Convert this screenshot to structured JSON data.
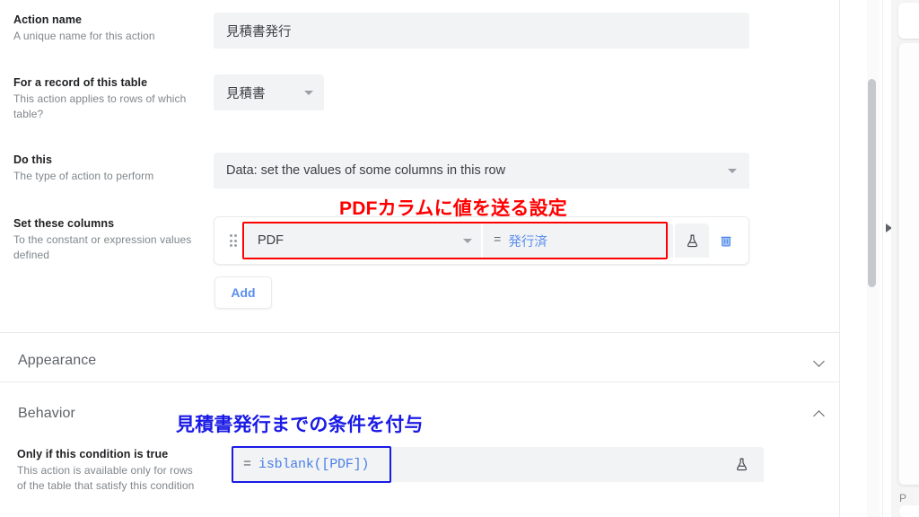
{
  "form": {
    "fields": [
      {
        "label": "Action name",
        "help": "A unique name for this action",
        "value": "見積書発行",
        "kind": "text"
      },
      {
        "label": "For a record of this table",
        "help": "This action applies to rows of which table?",
        "value": "見積書",
        "kind": "select"
      },
      {
        "label": "Do this",
        "help": "The type of action to perform",
        "value": "Data: set the values of some columns in this row",
        "kind": "select"
      },
      {
        "label": "Set these columns",
        "help": "To the constant or expression values defined",
        "kind": "rows"
      }
    ]
  },
  "set_columns_row": {
    "drag_handle_icon": "drag-dots-icon",
    "column": "PDF",
    "equals_sign": "=",
    "value_expression": "発行済",
    "flask_icon": "flask-icon",
    "delete_icon": "trash-icon"
  },
  "add_button": {
    "label": "Add"
  },
  "sections": [
    {
      "title": "Appearance",
      "chevron": "chevron-down-icon",
      "expanded": false
    },
    {
      "title": "Behavior",
      "chevron": "chevron-up-icon",
      "expanded": true
    }
  ],
  "behavior": {
    "condition_label": "Only if this condition is true",
    "condition_help": "This action is available only for rows of the table that satisfy this condition",
    "equals_sign": "=",
    "condition_expression": "isblank([PDF])",
    "flask_icon": "flask-icon"
  },
  "annotations": [
    {
      "text": "PDFカラムに値を送る設定",
      "color": "#ff0000"
    },
    {
      "text": "見積書発行までの条件を付与",
      "color": "#1a1ae6"
    }
  ],
  "right_gutter": {
    "expand_arrow_icon": "triangle-right-icon",
    "scrollbar": "vertical-scrollbar",
    "side_panel_label": "P"
  },
  "colors": {
    "annotation_red": "#ff0000",
    "annotation_blue": "#1a1ae6",
    "accent_blue": "#5b8def",
    "field_bg": "#f1f3f4",
    "text_primary": "#202124",
    "text_secondary": "#80868b"
  }
}
